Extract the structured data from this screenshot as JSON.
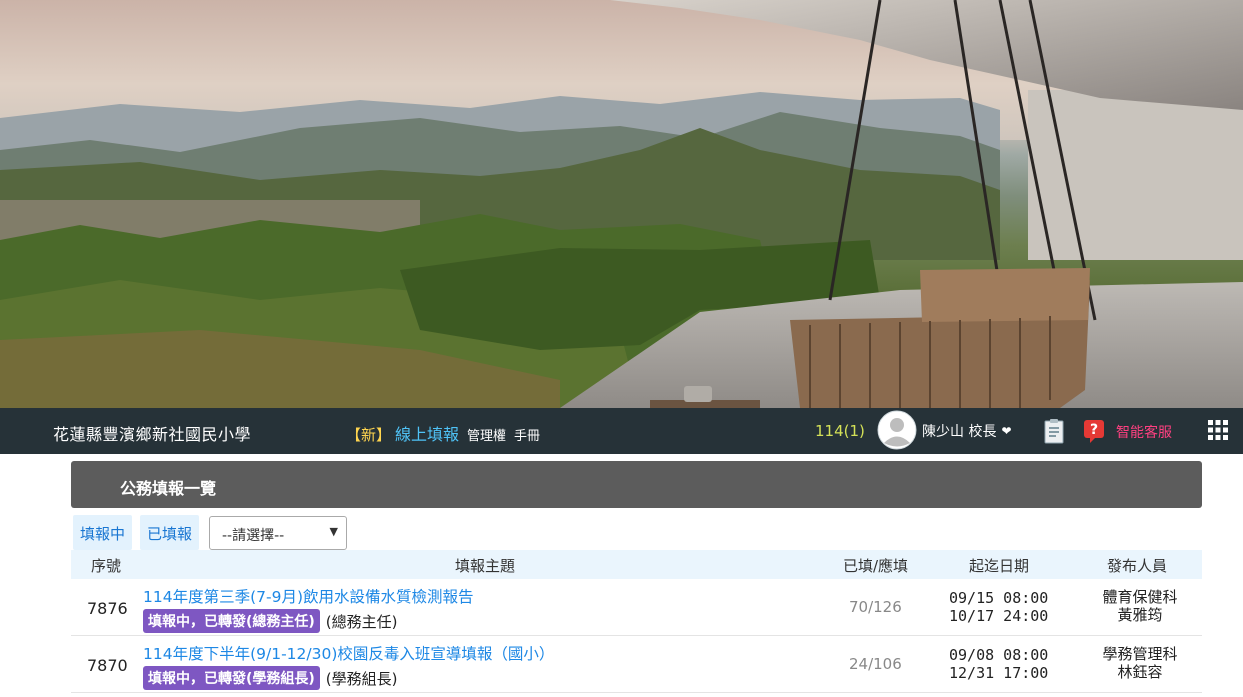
{
  "navbar": {
    "school_name": "花蓮縣豐濱鄉新社國民小學",
    "new_tag": "【新】",
    "app_title": "線上填報",
    "admin_link": "管理權",
    "manual_link": "手冊",
    "school_year": "114(1)",
    "user_name": "陳少山 校長",
    "service_label": "智能客服",
    "icons": [
      "avatar-icon",
      "chevron-down-icon",
      "document-icon",
      "help-icon",
      "apps-grid-icon"
    ],
    "colors": {
      "bar": "#263238",
      "year": "#d4e157",
      "app_title": "#4fc3f7",
      "service": "#ff4081"
    }
  },
  "panel": {
    "title": "公務填報一覽"
  },
  "filters": {
    "tab_filling": "填報中",
    "tab_filled": "已填報",
    "select_value": "--請選擇--"
  },
  "table": {
    "headers": [
      "序號",
      "填報主題",
      "已填/應填",
      "起迄日期",
      "發布人員"
    ],
    "rows": [
      {
        "id": "7876",
        "title": "114年度第三季(7-9月)飲用水設備水質檢測報告",
        "status": "填報中，已轉發(總務主任)",
        "forward_to": "(總務主任)",
        "count": "70/126",
        "start": "09/15 08:00",
        "end": "10/17 24:00",
        "dept": "體育保健科",
        "person": "黃雅筠"
      },
      {
        "id": "7870",
        "title": "114年度下半年(9/1-12/30)校園反毒入班宣導填報（國小）",
        "status": "填報中，已轉發(學務組長)",
        "forward_to": "(學務組長)",
        "count": "24/106",
        "start": "09/08 08:00",
        "end": "12/31 17:00",
        "dept": "學務管理科",
        "person": "林鈺容"
      }
    ]
  }
}
